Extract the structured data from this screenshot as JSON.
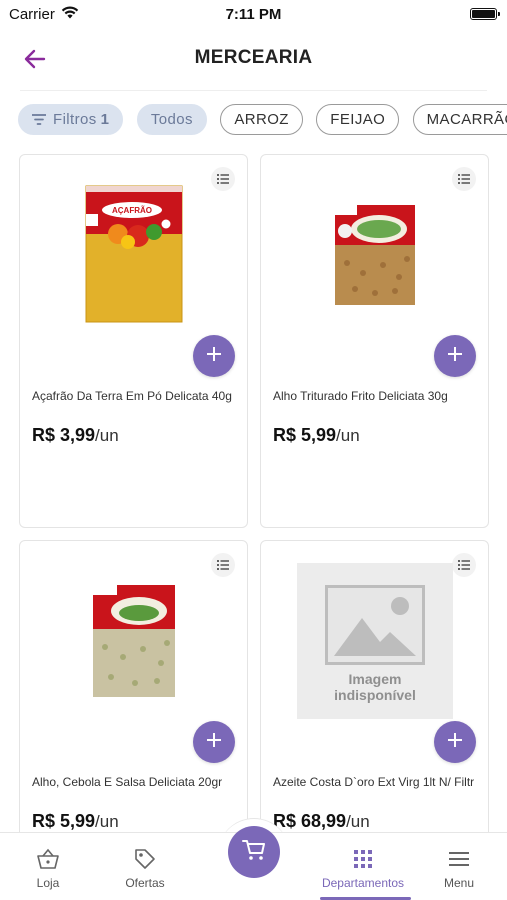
{
  "status_bar": {
    "carrier": "Carrier",
    "time": "7:11 PM"
  },
  "header": {
    "title": "MERCEARIA",
    "back_icon": "arrow-left-icon"
  },
  "filters": {
    "filter_chip": {
      "label": "Filtros",
      "count": "1",
      "icon": "filter-icon"
    },
    "chips": [
      "Todos",
      "ARROZ",
      "FEIJAO",
      "MACARRÃO"
    ]
  },
  "products": [
    {
      "name": "Açafrão Da Terra Em Pó Delicata 40g",
      "price": "R$ 3,99",
      "unit": "/un",
      "image": "acafrao-package"
    },
    {
      "name": "Alho Triturado Frito Deliciata 30g",
      "price": "R$ 5,99",
      "unit": "/un",
      "image": "alho-package"
    },
    {
      "name": "Alho, Cebola E Salsa Deliciata 20gr",
      "price": "R$ 5,99",
      "unit": "/un",
      "image": "alho-cebola-package"
    },
    {
      "name": "Azeite Costa D`oro Ext Virg 1lt N/ Filtr",
      "price": "R$ 68,99",
      "unit": "/un",
      "image_placeholder": [
        "Imagem",
        "indisponível"
      ]
    }
  ],
  "bottom_nav": {
    "items": [
      {
        "label": "Loja",
        "icon": "basket-icon"
      },
      {
        "label": "Ofertas",
        "icon": "tag-icon"
      },
      {
        "label": "Departamentos",
        "icon": "grid-icon",
        "active": true
      },
      {
        "label": "Menu",
        "icon": "hamburger-icon"
      }
    ],
    "cart_icon": "cart-icon"
  },
  "colors": {
    "accent": "#7b68b8",
    "chip_filled_bg": "#dbe3ef",
    "chip_filled_text": "#6b7a99",
    "back_arrow": "#8a2b9c"
  }
}
